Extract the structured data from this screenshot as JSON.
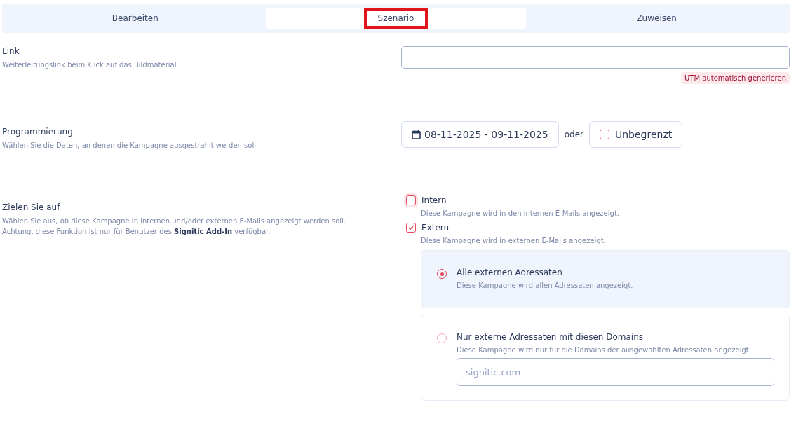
{
  "tabs": [
    {
      "label": "Bearbeiten",
      "selected": false,
      "highlighted": false
    },
    {
      "label": "Szenario",
      "selected": true,
      "highlighted": true
    },
    {
      "label": "Zuweisen",
      "selected": false,
      "highlighted": false
    }
  ],
  "link": {
    "title": "Link",
    "description": "Weiterleitungslink beim Klick auf das Bildmaterial.",
    "badge": "UTM automatisch generieren"
  },
  "scheduling": {
    "title": "Programmierung",
    "description": "Wählen Sie die Daten, an denen die Kampagne ausgestrahlt werden soll.",
    "date_range": "08-11-2025 - 09-11-2025",
    "separator": "oder",
    "unlimited": {
      "label": "Unbegrenzt",
      "checked": false
    }
  },
  "targeting": {
    "title": "Zielen Sie auf",
    "description": "Wählen Sie aus, ob diese Kampagne in internen und/oder externen E-Mails angezeigt werden soll.",
    "note_before": "Achtung, diese Funktion ist nur für Benutzer des",
    "note_link": "Signitic Add-In",
    "note_after": "verfügbar.",
    "options": [
      {
        "label": "Intern",
        "description": "Diese Kampagne wird in den internen E-Mails angezeigt.",
        "checked": false
      },
      {
        "label": "Extern",
        "description": "Diese Kampagne wird in externen E-Mails angezeigt.",
        "checked": true
      }
    ],
    "recipients": [
      {
        "label": "Alle externen Adressaten",
        "description": "Diese Kampagne wird allen Adressaten angezeigt.",
        "selected": true
      },
      {
        "label": "Nur externe Adressaten mit diesen Domains",
        "description": "Diese Kampagne wird nur für die Domains der ausgewählten Adressaten angezeigt.",
        "selected": false,
        "placeholder": "signitic.com"
      }
    ]
  }
}
